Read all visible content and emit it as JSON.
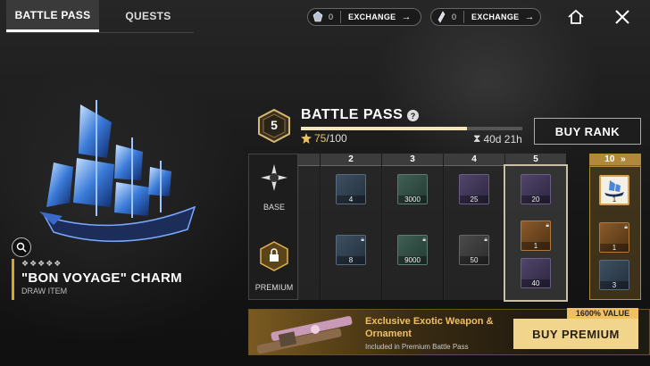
{
  "tabs": [
    {
      "label": "BATTLE PASS",
      "active": true
    },
    {
      "label": "QUESTS",
      "active": false
    }
  ],
  "currencies": [
    {
      "icon": "silver-gem-icon",
      "count": "0",
      "action": "EXCHANGE"
    },
    {
      "icon": "crystal-shard-icon",
      "count": "0",
      "action": "EXCHANGE"
    }
  ],
  "top_icons": [
    "home-icon",
    "close-icon"
  ],
  "featured_item": {
    "stars": "❖❖❖❖❖",
    "name": "\"BON VOYAGE\" CHARM",
    "type": "DRAW ITEM"
  },
  "battle_pass": {
    "rank": "5",
    "title": "BATTLE PASS",
    "help": "?",
    "xp_current": "75",
    "xp_max": "/100",
    "xp_fraction": 0.75,
    "timer": "40d 21h",
    "buy_rank_label": "BUY RANK"
  },
  "tracks": {
    "base_label": "BASE",
    "premium_label": "PREMIUM"
  },
  "columns": [
    {
      "rank": "2",
      "base": {
        "qty": "4",
        "color": "blue"
      },
      "premium": {
        "qty": "8",
        "color": "blue"
      }
    },
    {
      "rank": "3",
      "base": {
        "qty": "3000",
        "color": "green"
      },
      "premium": {
        "qty": "9000",
        "color": "green"
      }
    },
    {
      "rank": "4",
      "base": {
        "qty": "25",
        "color": "purple"
      },
      "premium": {
        "qty": "50",
        "color": "grey"
      }
    },
    {
      "rank": "5",
      "base": {
        "qty": "20",
        "color": "purple"
      },
      "premium": {
        "qty": "1",
        "color": "orange"
      },
      "premium2": {
        "qty": "40",
        "color": "purple"
      },
      "selected": true
    },
    {
      "rank": "10",
      "base": {
        "qty": "1",
        "color": "white"
      },
      "premium": {
        "qty": "1",
        "color": "orange"
      },
      "premium2": {
        "qty": "3",
        "color": "blue"
      },
      "gold": true
    }
  ],
  "premium_banner": {
    "title": "Exclusive Exotic Weapon & Ornament",
    "subtitle": "Included in Premium Battle Pass",
    "value_badge": "1600% VALUE",
    "button_label": "BUY PREMIUM"
  }
}
